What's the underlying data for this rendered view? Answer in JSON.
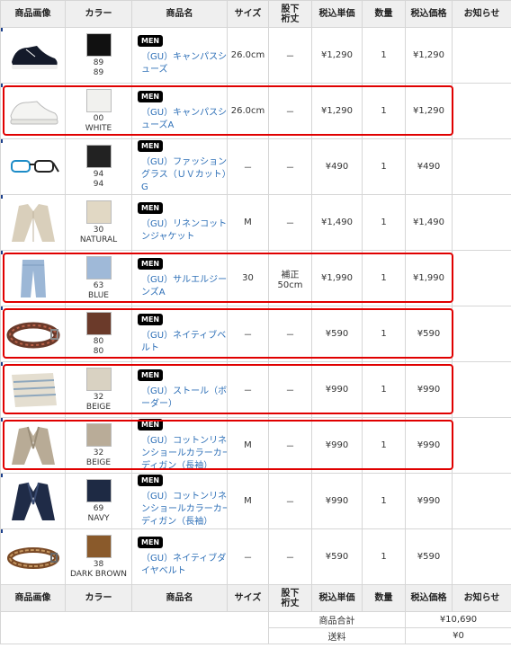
{
  "headers": {
    "image": "商品画像",
    "color": "カラー",
    "name": "商品名",
    "size": "サイズ",
    "inseam_line1": "股下",
    "inseam_line2": "裄丈",
    "unit_price": "税込単価",
    "qty": "数量",
    "total_price": "税込価格",
    "notice": "お知らせ"
  },
  "items": [
    {
      "tag": "MEN",
      "name": "（GU）キャンパスシューズ",
      "color_code": "89",
      "color_name": "89",
      "size": "26.0cm",
      "inseam": "－",
      "unit_price": "¥1,290",
      "qty": "1",
      "total": "¥1,290",
      "highlighted": false,
      "swatch": "#111111",
      "image": "sneaker-black"
    },
    {
      "tag": "MEN",
      "name": "（GU）キャンパスシューズA",
      "color_code": "00",
      "color_name": "WHITE",
      "size": "26.0cm",
      "inseam": "－",
      "unit_price": "¥1,290",
      "qty": "1",
      "total": "¥1,290",
      "highlighted": true,
      "swatch": "#f1f1ee",
      "image": "sneaker-white"
    },
    {
      "tag": "MEN",
      "name": "（GU）ファッショングラス（ＵＶカット）G",
      "color_code": "94",
      "color_name": "94",
      "size": "－",
      "inseam": "－",
      "unit_price": "¥490",
      "qty": "1",
      "total": "¥490",
      "highlighted": false,
      "swatch": "#222222",
      "image": "glasses"
    },
    {
      "tag": "MEN",
      "name": "（GU）リネンコットンジャケット",
      "color_code": "30",
      "color_name": "NATURAL",
      "size": "M",
      "inseam": "－",
      "unit_price": "¥1,490",
      "qty": "1",
      "total": "¥1,490",
      "highlighted": false,
      "swatch": "#e1d8c4",
      "image": "jacket-natural"
    },
    {
      "tag": "MEN",
      "name": "（GU）サルエルジーンズA",
      "color_code": "63",
      "color_name": "BLUE",
      "size": "30",
      "inseam": "補正\n50cm",
      "unit_price": "¥1,990",
      "qty": "1",
      "total": "¥1,990",
      "highlighted": true,
      "swatch": "#9fb9d8",
      "image": "jeans"
    },
    {
      "tag": "MEN",
      "name": "（GU）ネイティブベルト",
      "color_code": "80",
      "color_name": "80",
      "size": "－",
      "inseam": "－",
      "unit_price": "¥590",
      "qty": "1",
      "total": "¥590",
      "highlighted": true,
      "swatch": "#6b3a2a",
      "image": "belt-native"
    },
    {
      "tag": "MEN",
      "name": "（GU）ストール（ボーダー）",
      "color_code": "32",
      "color_name": "BEIGE",
      "size": "－",
      "inseam": "－",
      "unit_price": "¥990",
      "qty": "1",
      "total": "¥990",
      "highlighted": true,
      "swatch": "#d9d2c2",
      "image": "stole"
    },
    {
      "tag": "MEN",
      "name": "（GU）コットンリネンショールカラーカーディガン（長袖）",
      "color_code": "32",
      "color_name": "BEIGE",
      "size": "M",
      "inseam": "－",
      "unit_price": "¥990",
      "qty": "1",
      "total": "¥990",
      "highlighted": true,
      "swatch": "#b9ac98",
      "image": "cardigan-beige"
    },
    {
      "tag": "MEN",
      "name": "（GU）コットンリネンショールカラーカーディガン（長袖）",
      "color_code": "69",
      "color_name": "NAVY",
      "size": "M",
      "inseam": "－",
      "unit_price": "¥990",
      "qty": "1",
      "total": "¥990",
      "highlighted": false,
      "swatch": "#1e2a44",
      "image": "cardigan-navy"
    },
    {
      "tag": "MEN",
      "name": "（GU）ネイティブダイヤベルト",
      "color_code": "38",
      "color_name": "DARK BROWN",
      "size": "－",
      "inseam": "－",
      "unit_price": "¥590",
      "qty": "1",
      "total": "¥590",
      "highlighted": false,
      "swatch": "#8a5a2b",
      "image": "belt-diamond"
    }
  ],
  "summary": {
    "subtotal_label": "商品合計",
    "subtotal_value": "¥10,690",
    "shipping_label": "送料",
    "shipping_value": "¥0"
  },
  "colors": {
    "link": "#2d6fb7",
    "highlight": "#e00000",
    "header_bg": "#efefef",
    "border": "#d6d6d6"
  }
}
